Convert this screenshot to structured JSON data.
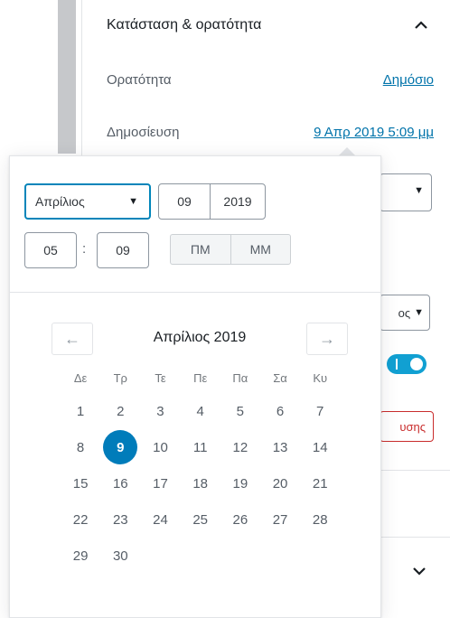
{
  "panel": {
    "title": "Κατάσταση & ορατότητα",
    "visibility_label": "Ορατότητα",
    "visibility_value": "Δημόσιο",
    "publish_label": "Δημοσίευση",
    "publish_value": "9 Απρ 2019 5:09 μμ"
  },
  "background": {
    "select2_text": "ος",
    "red_button_text": "υσης"
  },
  "datetime": {
    "month": "Απρίλιος",
    "day": "09",
    "year": "2019",
    "hour": "05",
    "colon": ":",
    "minute": "09",
    "pm_label": "ΠΜ",
    "am_label": "ΜΜ"
  },
  "calendar": {
    "title": "Απρίλιος 2019",
    "prev_icon": "←",
    "next_icon": "→",
    "weekdays": [
      "Δε",
      "Τρ",
      "Τε",
      "Πε",
      "Πα",
      "Σα",
      "Κυ"
    ],
    "weeks": [
      [
        "1",
        "2",
        "3",
        "4",
        "5",
        "6",
        "7"
      ],
      [
        "8",
        "9",
        "10",
        "11",
        "12",
        "13",
        "14"
      ],
      [
        "15",
        "16",
        "17",
        "18",
        "19",
        "20",
        "21"
      ],
      [
        "22",
        "23",
        "24",
        "25",
        "26",
        "27",
        "28"
      ],
      [
        "29",
        "30",
        "",
        "",
        "",
        "",
        ""
      ]
    ],
    "selected_day": "9"
  },
  "colors": {
    "accent": "#007cba",
    "link": "#0073aa"
  }
}
